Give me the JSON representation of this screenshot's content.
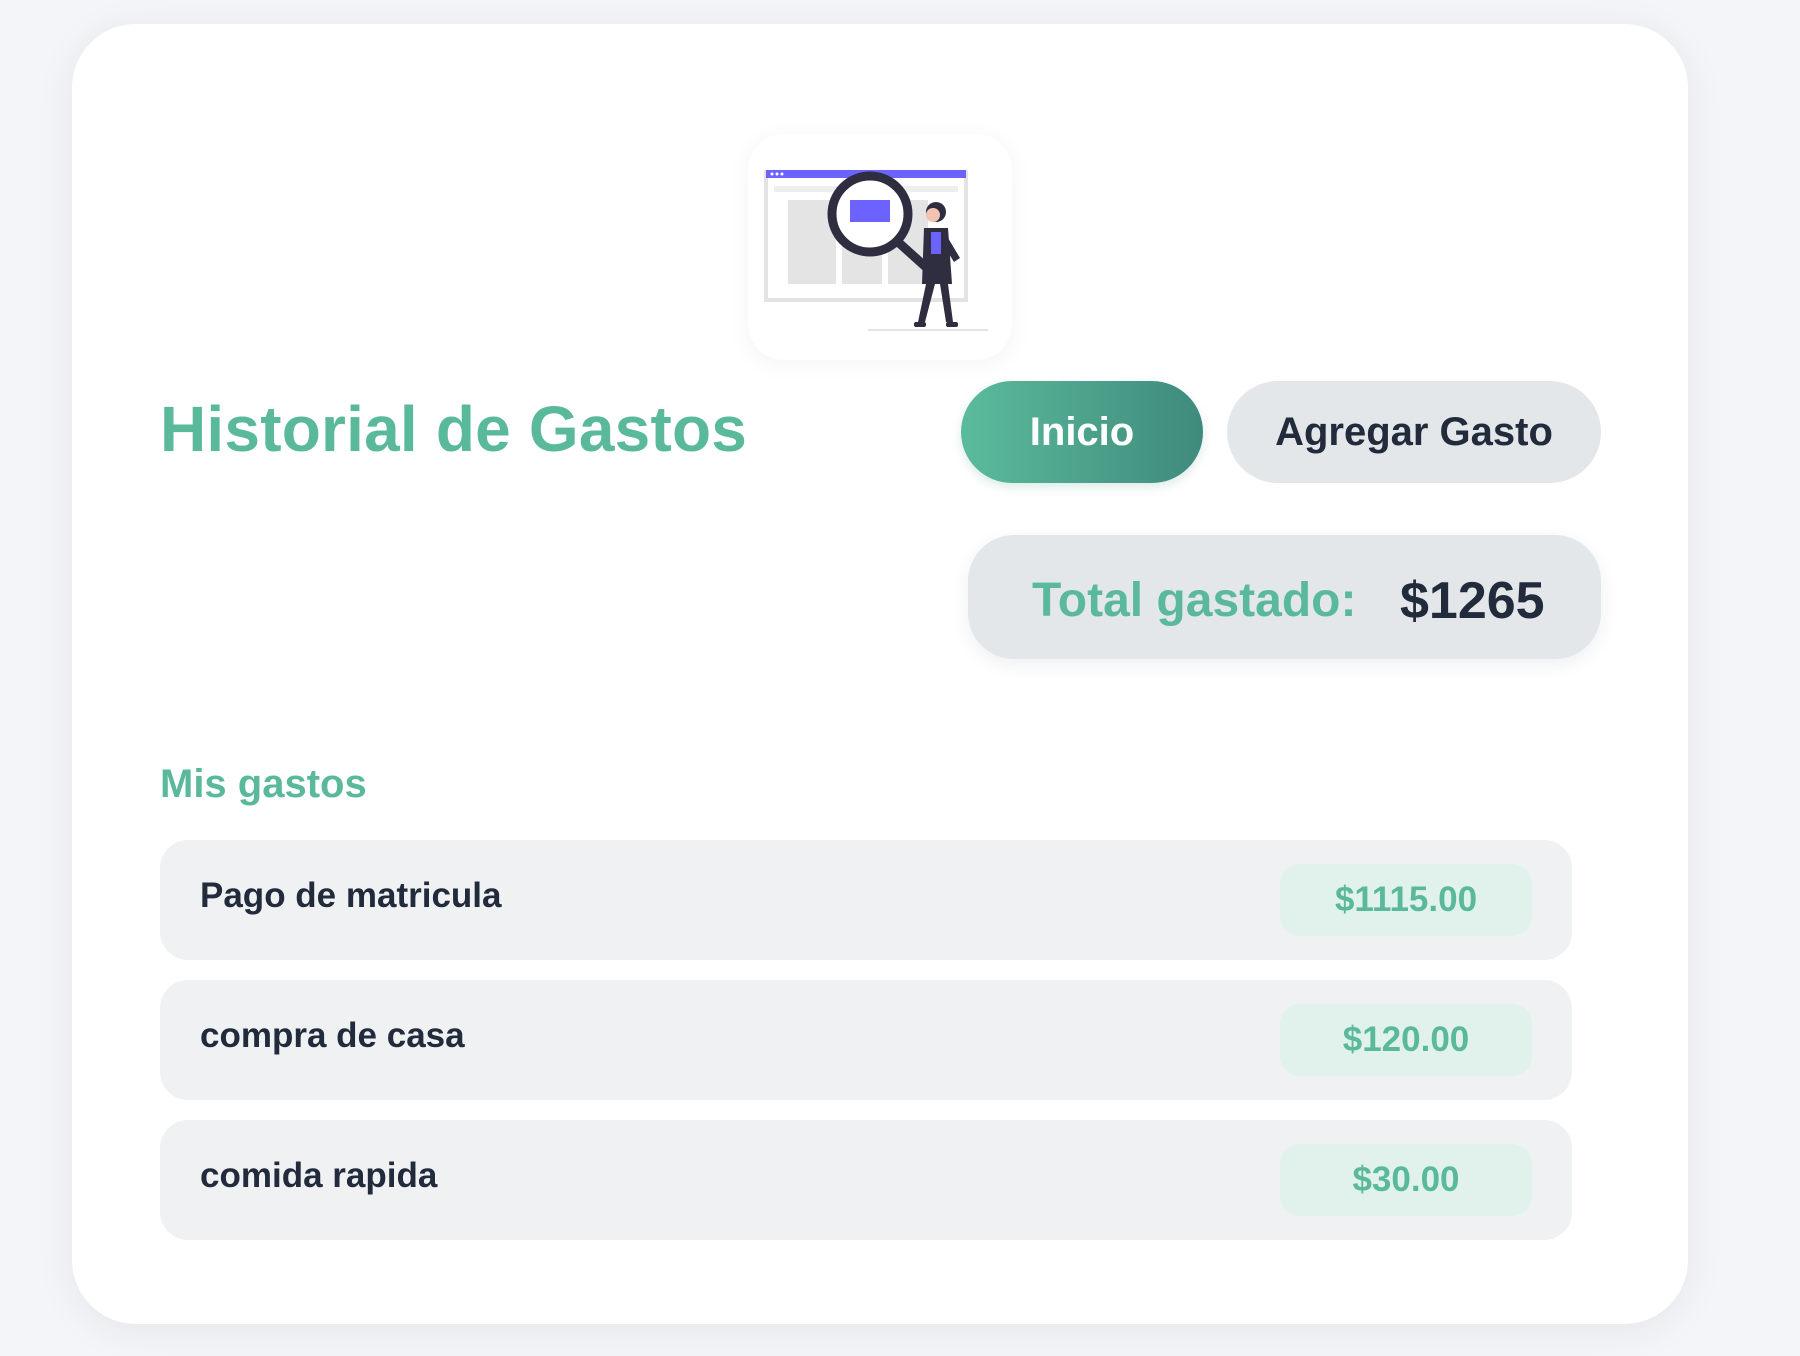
{
  "header": {
    "illustration_icon": "search-illustration-icon",
    "title": "Historial de Gastos"
  },
  "nav": {
    "home_label": "Inicio",
    "add_expense_label": "Agregar Gasto"
  },
  "summary": {
    "total_label": "Total gastado:",
    "total_value": "$1265"
  },
  "expenses": {
    "section_title": "Mis gastos",
    "items": [
      {
        "name": "Pago de matricula",
        "amount": "$1115.00"
      },
      {
        "name": "compra de casa",
        "amount": "$120.00"
      },
      {
        "name": "comida rapida",
        "amount": "$30.00"
      }
    ]
  },
  "colors": {
    "accent": "#5bb99b",
    "accent_dark": "#3f8a7c",
    "text_dark": "#222b3c",
    "panel_gray": "#e4e7ea",
    "row_gray": "#eff1f3",
    "amount_bg": "#e1f1ec",
    "illustration_purple": "#6c63ff"
  }
}
